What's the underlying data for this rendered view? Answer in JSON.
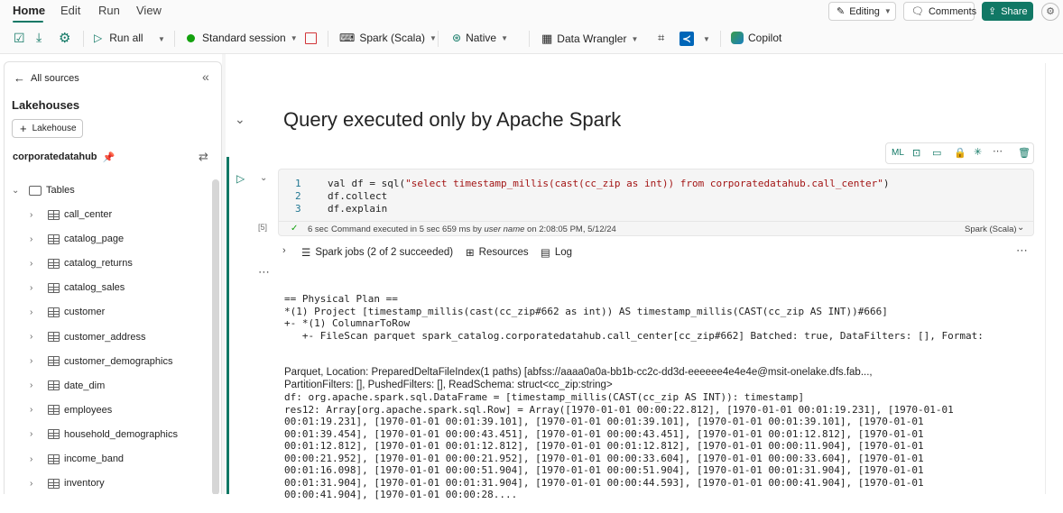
{
  "menu": {
    "tabs": [
      "Home",
      "Edit",
      "Run",
      "View"
    ],
    "active": "Home"
  },
  "header": {
    "editing_label": "Editing",
    "comments_label": "Comments",
    "share_label": "Share"
  },
  "ribbon": {
    "run_all": "Run all",
    "session": "Standard session",
    "language": "Spark (Scala)",
    "engine": "Native",
    "data_wrangler": "Data Wrangler",
    "copilot": "Copilot",
    "session_color": "#13a10e"
  },
  "sidebar": {
    "back_label": "All sources",
    "section_title": "Lakehouses",
    "add_lakehouse": "Lakehouse",
    "lakehouse_name": "corporatedatahub",
    "tables_label": "Tables",
    "tables": [
      "call_center",
      "catalog_page",
      "catalog_returns",
      "catalog_sales",
      "customer",
      "customer_address",
      "customer_demographics",
      "date_dim",
      "employees",
      "household_demographics",
      "income_band",
      "inventory"
    ]
  },
  "notebook": {
    "heading": "Query executed only by Apache Spark",
    "cell_toolbar_ml": "ML",
    "exec_count": "[5]",
    "code_lines": [
      {
        "n": "1",
        "pre": "val df = sql(",
        "str": "\"select timestamp_millis(cast(cc_zip as int)) from corporatedatahub.call_center\"",
        "post": ")"
      },
      {
        "n": "2",
        "pre": "df.collect",
        "str": "",
        "post": ""
      },
      {
        "n": "3",
        "pre": "df.explain",
        "str": "",
        "post": ""
      }
    ],
    "status_time": "6 sec",
    "status_prefix": "Command executed in 5 sec 659 ms by ",
    "status_user": "user name",
    "status_suffix": " on 2:08:05 PM, 5/12/24",
    "status_lang": "Spark (Scala)",
    "spark_jobs": "Spark jobs (2 of 2 succeeded)",
    "resources": "Resources",
    "log": "Log",
    "plan_mono": [
      "== Physical Plan ==",
      "*(1) Project [timestamp_millis(cast(cc_zip#662 as int)) AS timestamp_millis(CAST(cc_zip AS INT))#666]",
      "+- *(1) ColumnarToRow",
      "   +- FileScan parquet spark_catalog.corporatedatahub.call_center[cc_zip#662] Batched: true, DataFilters: [], Format:"
    ],
    "plan_wrap": [
      "Parquet, Location: PreparedDeltaFileIndex(1 paths) [abfss://aaaa0a0a-bb1b-cc2c-dd3d-eeeeee4e4e4e@msit-onelake.dfs.fab...,",
      "PartitionFilters: [], PushedFilters: [], ReadSchema: struct<cc_zip:string>"
    ],
    "result_lines": [
      "df: org.apache.spark.sql.DataFrame = [timestamp_millis(CAST(cc_zip AS INT)): timestamp]",
      "res12: Array[org.apache.spark.sql.Row] = Array([1970-01-01 00:00:22.812], [1970-01-01 00:01:19.231], [1970-01-01",
      "00:01:19.231], [1970-01-01 00:01:39.101], [1970-01-01 00:01:39.101], [1970-01-01 00:01:39.101], [1970-01-01",
      "00:01:39.454], [1970-01-01 00:00:43.451], [1970-01-01 00:00:43.451], [1970-01-01 00:01:12.812], [1970-01-01",
      "00:01:12.812], [1970-01-01 00:01:12.812], [1970-01-01 00:01:12.812], [1970-01-01 00:00:11.904], [1970-01-01",
      "00:00:21.952], [1970-01-01 00:00:21.952], [1970-01-01 00:00:33.604], [1970-01-01 00:00:33.604], [1970-01-01",
      "00:01:16.098], [1970-01-01 00:00:51.904], [1970-01-01 00:00:51.904], [1970-01-01 00:01:31.904], [1970-01-01",
      "00:01:31.904], [1970-01-01 00:01:31.904], [1970-01-01 00:00:44.593], [1970-01-01 00:00:41.904], [1970-01-01",
      "00:00:41.904], [1970-01-01 00:00:28...."
    ]
  }
}
